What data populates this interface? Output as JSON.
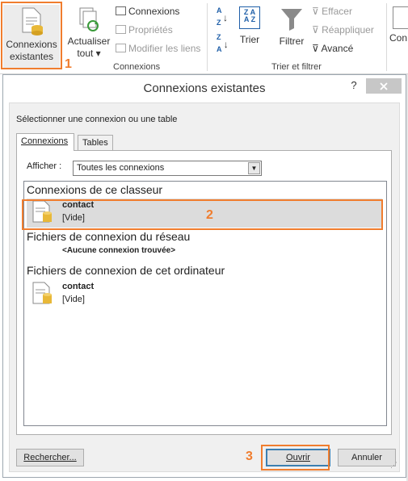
{
  "ribbon": {
    "connexions_existantes": [
      "Connexions",
      "existantes"
    ],
    "actualiser": [
      "Actualiser",
      "tout"
    ],
    "connexions": "Connexions",
    "proprietes": "Propriétés",
    "modifier_liens": "Modifier les liens",
    "group_connexions": "Connexions",
    "sort_az": "A→Z",
    "sort_za": "Z→A",
    "trier": "Trier",
    "filtrer": "Filtrer",
    "effacer": "Effacer",
    "reappliquer": "Réappliquer",
    "avance": "Avancé",
    "group_trier": "Trier et filtrer",
    "con_partial": "Con",
    "badge1": "1"
  },
  "dialog": {
    "title": "Connexions existantes",
    "help": "?",
    "prompt": "Sélectionner une connexion ou une table",
    "tabs": [
      "Connexions",
      "Tables"
    ],
    "afficher_label": "Afficher :",
    "afficher_value": "Toutes les connexions",
    "sections": {
      "classeur": "Connexions de ce classeur",
      "reseau": "Fichiers de connexion du réseau",
      "ordinateur": "Fichiers de connexion de cet ordinateur"
    },
    "classeur_item": {
      "name": "contact",
      "desc": "[Vide]"
    },
    "reseau_none": "<Aucune connexion trouvée>",
    "ordinateur_item": {
      "name": "contact",
      "desc": "[Vide]"
    },
    "badge2": "2",
    "badge3": "3",
    "buttons": {
      "rechercher": "Rechercher...",
      "ouvrir": "Ouvrir",
      "annuler": "Annuler"
    }
  },
  "colors": {
    "highlight": "#f07d2e",
    "selected_row": "#dcdcdc",
    "accent": "#3c7fb1"
  }
}
